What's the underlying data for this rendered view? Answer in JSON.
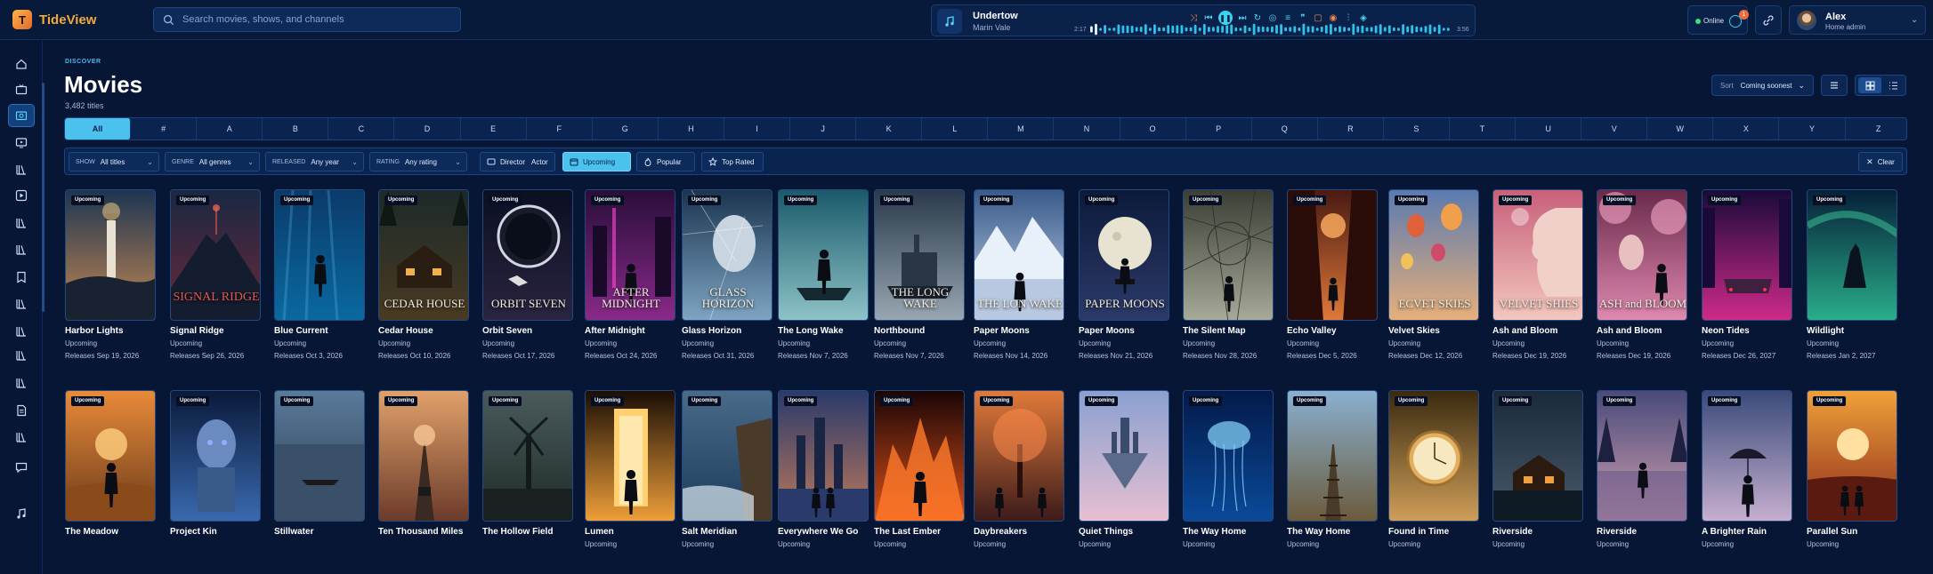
{
  "app": {
    "name": "TideView",
    "logo_letter": "T"
  },
  "search": {
    "placeholder": "Search movies, shows, and channels"
  },
  "player": {
    "title": "Undertow",
    "artist": "Marin Vale",
    "elapsed": "2:17",
    "duration": "3:56",
    "progress": 0.03
  },
  "status": {
    "online_label": "Online",
    "notifications": "1"
  },
  "user": {
    "name": "Alex",
    "role": "Home admin"
  },
  "sidebar": {
    "items": [
      {
        "icon": "home-icon"
      },
      {
        "icon": "tv-icon"
      },
      {
        "icon": "movies-icon",
        "active": true
      },
      {
        "icon": "shows-icon"
      },
      {
        "icon": "library-icon"
      },
      {
        "icon": "play-box-icon"
      },
      {
        "icon": "library-icon"
      },
      {
        "icon": "library-icon"
      },
      {
        "icon": "bookmark-icon"
      },
      {
        "icon": "library-icon"
      },
      {
        "icon": "library-icon"
      },
      {
        "icon": "library-icon"
      },
      {
        "icon": "library-icon"
      },
      {
        "icon": "document-icon"
      },
      {
        "icon": "library-icon"
      },
      {
        "icon": "chat-icon"
      },
      {
        "icon": "music-icon"
      }
    ]
  },
  "header": {
    "eyebrow": "DISCOVER",
    "title": "Movies",
    "count": "3,482 titles"
  },
  "sort": {
    "label": "Sort",
    "value": "Coming soonest"
  },
  "alphabet": [
    "All",
    "#",
    "A",
    "B",
    "C",
    "D",
    "E",
    "F",
    "G",
    "H",
    "I",
    "J",
    "K",
    "L",
    "M",
    "N",
    "O",
    "P",
    "Q",
    "R",
    "S",
    "T",
    "U",
    "V",
    "W",
    "X",
    "Y",
    "Z"
  ],
  "filters": {
    "show": {
      "label": "SHOW",
      "value": "All titles"
    },
    "genre": {
      "label": "GENRE",
      "value": "All genres"
    },
    "released": {
      "label": "RELEASED",
      "value": "Any year"
    },
    "rating": {
      "label": "RATING",
      "value": "Any rating"
    },
    "person": {
      "director": "Director",
      "actor": "Actor"
    },
    "upcoming": "Upcoming",
    "popular": "Popular",
    "top_rated": "Top Rated",
    "clear": "Clear"
  },
  "badge_label": "Upcoming",
  "row1": [
    {
      "title": "Harbor Lights",
      "status": "Upcoming",
      "release": "Releases Sep 19, 2026",
      "poster_text": "",
      "art": "lighthouse",
      "c1": "#1c3552",
      "c2": "#c98a52"
    },
    {
      "title": "Signal Ridge",
      "status": "Upcoming",
      "release": "Releases Sep 26, 2026",
      "poster_text": "SIGNAL RIDGE",
      "art": "mountain",
      "c1": "#1a2742",
      "c2": "#6b2a3a"
    },
    {
      "title": "Blue Current",
      "status": "Upcoming",
      "release": "Releases Oct 3, 2026",
      "poster_text": "",
      "art": "underwater",
      "c1": "#0a3a6a",
      "c2": "#0a6aa0"
    },
    {
      "title": "Cedar House",
      "status": "Upcoming",
      "release": "Releases Oct 10, 2026",
      "poster_text": "CEDAR HOUSE",
      "art": "house",
      "c1": "#1c2a2a",
      "c2": "#4a3a22"
    },
    {
      "title": "Orbit Seven",
      "status": "Upcoming",
      "release": "Releases Oct 17, 2026",
      "poster_text": "ORBIT SEVEN",
      "art": "space",
      "c1": "#0b0f22",
      "c2": "#2a2440"
    },
    {
      "title": "After Midnight",
      "status": "Upcoming",
      "release": "Releases Oct 24, 2026",
      "poster_text": "AFTER MIDNIGHT",
      "art": "city",
      "c1": "#2a0e3a",
      "c2": "#8a2a8a"
    },
    {
      "title": "Glass Horizon",
      "status": "Upcoming",
      "release": "Releases Oct 31, 2026",
      "poster_text": "GLASS HORIZON",
      "art": "face",
      "c1": "#1b3550",
      "c2": "#7fa6c4"
    },
    {
      "title": "The Long Wake",
      "status": "Upcoming",
      "release": "Releases Nov 7, 2026",
      "poster_text": "",
      "art": "boat",
      "c1": "#1a5a6a",
      "c2": "#8fc4c8"
    },
    {
      "title": "Northbound",
      "status": "Upcoming",
      "release": "Releases Nov 7, 2026",
      "poster_text": "THE LONG WAKE",
      "art": "ship",
      "c1": "#2a3a4a",
      "c2": "#9aa8b4"
    },
    {
      "title": "Paper Moons",
      "status": "Upcoming",
      "release": "Releases Nov 14, 2026",
      "poster_text": "THE LON WAKE",
      "art": "peaks",
      "c1": "#3a5a8a",
      "c2": "#c8d8ec"
    },
    {
      "title": "Paper Moons",
      "status": "Upcoming",
      "release": "Releases Nov 21, 2026",
      "poster_text": "PAPER MOONS",
      "art": "moon",
      "c1": "#0c1a3a",
      "c2": "#2c3a6a"
    },
    {
      "title": "The Silent Map",
      "status": "Upcoming",
      "release": "Releases Nov 28, 2026",
      "poster_text": "",
      "art": "map",
      "c1": "#3a3e34",
      "c2": "#a8ab9a"
    },
    {
      "title": "Echo Valley",
      "status": "Upcoming",
      "release": "Releases Dec 5, 2026",
      "poster_text": "",
      "art": "canyon",
      "c1": "#4a1a12",
      "c2": "#e07a3a"
    },
    {
      "title": "Velvet Skies",
      "status": "Upcoming",
      "release": "Releases Dec 12, 2026",
      "poster_text": "ECVET SKIES",
      "art": "balloons",
      "c1": "#5a7ab0",
      "c2": "#e8b07a"
    },
    {
      "title": "Ash and Bloom",
      "status": "Upcoming",
      "release": "Releases Dec 19, 2026",
      "poster_text": "VELVET SHIES",
      "art": "profile",
      "c1": "#c8607a",
      "c2": "#f4c8c0"
    },
    {
      "title": "Ash and Bloom",
      "status": "Upcoming",
      "release": "Releases Dec 19, 2026",
      "poster_text": "ASH and BLOOM",
      "art": "blossom",
      "c1": "#6a2a4a",
      "c2": "#e08ab0"
    },
    {
      "title": "Neon Tides",
      "status": "Upcoming",
      "release": "Releases Dec 26, 2027",
      "poster_text": "",
      "art": "neon",
      "c1": "#1a0a3a",
      "c2": "#d02a8a"
    },
    {
      "title": "Wildlight",
      "status": "Upcoming",
      "release": "Releases Jan 2, 2027",
      "poster_text": "",
      "art": "wolf",
      "c1": "#06203a",
      "c2": "#2ab08a"
    }
  ],
  "row2": [
    {
      "title": "The Meadow",
      "status": "",
      "poster_text": "",
      "art": "meadow",
      "c1": "#e88a3a",
      "c2": "#6a3a1a"
    },
    {
      "title": "Project Kin",
      "status": "",
      "poster_text": "",
      "art": "robot",
      "c1": "#0a1a3a",
      "c2": "#3a6ab0"
    },
    {
      "title": "Stillwater",
      "status": "",
      "poster_text": "",
      "art": "lake",
      "c1": "#5a7a9a",
      "c2": "#2a3e52"
    },
    {
      "title": "Ten Thousand Miles",
      "status": "",
      "poster_text": "",
      "art": "road",
      "c1": "#e0a06a",
      "c2": "#6a3a2a"
    },
    {
      "title": "The Hollow Field",
      "status": "",
      "poster_text": "",
      "art": "windmill",
      "c1": "#4a5a5a",
      "c2": "#1e2a2a"
    },
    {
      "title": "Lumen",
      "status": "Upcoming",
      "poster_text": "",
      "art": "door",
      "c1": "#1a0e06",
      "c2": "#f0a03a"
    },
    {
      "title": "Salt Meridian",
      "status": "Upcoming",
      "poster_text": "",
      "art": "coast",
      "c1": "#4a6a8a",
      "c2": "#1a3a5a"
    },
    {
      "title": "Everywhere We Go",
      "status": "Upcoming",
      "poster_text": "",
      "art": "skyline",
      "c1": "#2a3a6a",
      "c2": "#c07a5a"
    },
    {
      "title": "The Last Ember",
      "status": "Upcoming",
      "poster_text": "",
      "art": "fire",
      "c1": "#1a0606",
      "c2": "#e0501a"
    },
    {
      "title": "Daybreakers",
      "status": "Upcoming",
      "poster_text": "",
      "art": "tree",
      "c1": "#e07a3a",
      "c2": "#3a1a1a"
    },
    {
      "title": "Quiet Things",
      "status": "Upcoming",
      "poster_text": "",
      "art": "island",
      "c1": "#8aa0d0",
      "c2": "#e8c0d0"
    },
    {
      "title": "The Way Home",
      "status": "Upcoming",
      "poster_text": "",
      "art": "jelly",
      "c1": "#041a4a",
      "c2": "#0a4a9a"
    },
    {
      "title": "The Way Home",
      "status": "Upcoming",
      "poster_text": "",
      "art": "tracks",
      "c1": "#8ab0d0",
      "c2": "#6a5a3a"
    },
    {
      "title": "Found in Time",
      "status": "Upcoming",
      "poster_text": "",
      "art": "watch",
      "c1": "#3a2a10",
      "c2": "#d0a05a"
    },
    {
      "title": "Riverside",
      "status": "Upcoming",
      "poster_text": "",
      "art": "cabin",
      "c1": "#1a2a3a",
      "c2": "#4a5a6a"
    },
    {
      "title": "Riverside",
      "status": "Upcoming",
      "poster_text": "",
      "art": "reflect",
      "c1": "#4a4a7a",
      "c2": "#d0a0b0"
    },
    {
      "title": "A Brighter Rain",
      "status": "Upcoming",
      "poster_text": "",
      "art": "umbrella",
      "c1": "#3a4a7a",
      "c2": "#c8b0d0"
    },
    {
      "title": "Parallel Sun",
      "status": "Upcoming",
      "poster_text": "",
      "art": "sunset",
      "c1": "#f0a03a",
      "c2": "#8a2a1a"
    }
  ]
}
